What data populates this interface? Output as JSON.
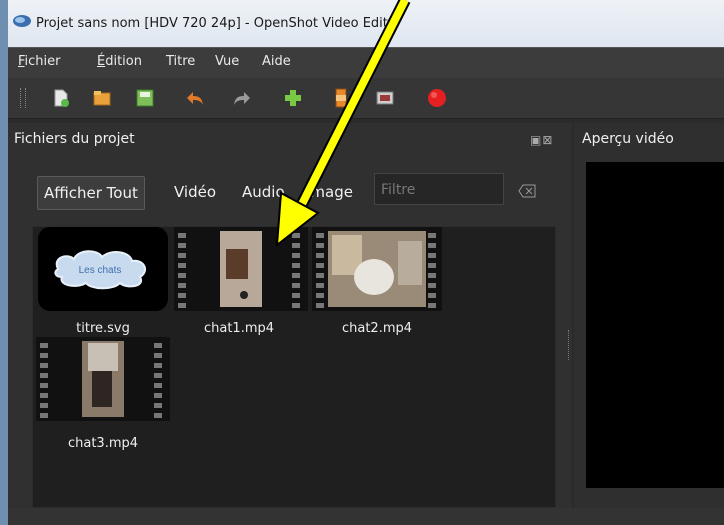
{
  "window": {
    "title": "Projet sans nom [HDV 720 24p] - OpenShot Video Editor"
  },
  "menu": {
    "items": [
      "Fichier",
      "Édition",
      "Titre",
      "Vue",
      "Aide"
    ]
  },
  "toolbar": {
    "icons": [
      "new-project-icon",
      "open-project-icon",
      "save-project-icon",
      "undo-icon",
      "redo-icon",
      "import-files-icon",
      "export-video-icon",
      "fullscreen-icon",
      "record-icon"
    ],
    "colors": {
      "undo": "#e07a2a",
      "add": "#7ac943",
      "record": "#e52020"
    }
  },
  "project_files": {
    "title": "Fichiers du projet",
    "filters": [
      "Afficher Tout",
      "Vidéo",
      "Audio",
      "Image"
    ],
    "filter_placeholder": "Filtre",
    "files": [
      {
        "name": "titre.svg",
        "thumb_text": "Les chats"
      },
      {
        "name": "chat1.mp4"
      },
      {
        "name": "chat2.mp4"
      },
      {
        "name": "chat3.mp4"
      }
    ]
  },
  "preview": {
    "title": "Aperçu vidéo"
  },
  "annotation": {
    "color": "#ffff00"
  }
}
